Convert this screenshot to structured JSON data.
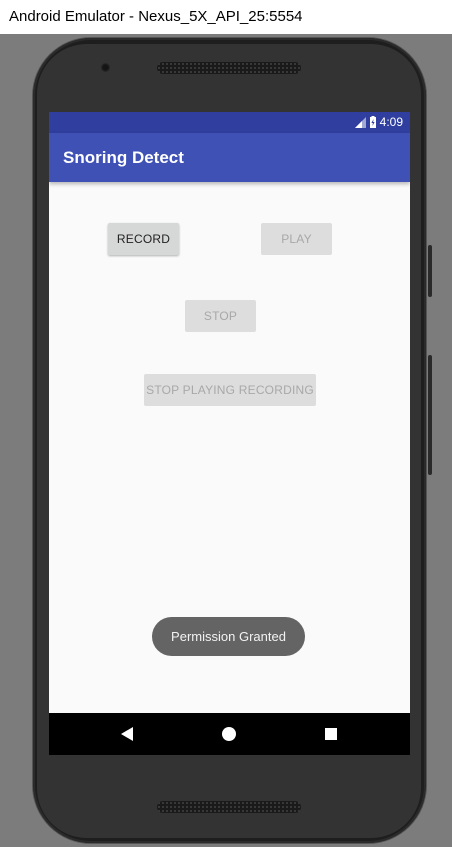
{
  "window": {
    "title": "Android Emulator - Nexus_5X_API_25:5554"
  },
  "status_bar": {
    "time": "4:09",
    "icons": [
      "signal-icon",
      "battery-icon"
    ]
  },
  "app_bar": {
    "title": "Snoring Detect"
  },
  "buttons": {
    "record": "RECORD",
    "play": "PLAY",
    "stop": "STOP",
    "stop_playing": "STOP PLAYING RECORDING"
  },
  "button_states": {
    "record": "enabled",
    "play": "disabled",
    "stop": "disabled",
    "stop_playing": "disabled"
  },
  "toast": {
    "message": "Permission Granted"
  },
  "nav_bar": {
    "icons": [
      "back-icon",
      "home-icon",
      "recents-icon"
    ]
  },
  "colors": {
    "primary": "#3f51b5",
    "primary_dark": "#303f9f",
    "screen_bg": "#fafafa"
  }
}
